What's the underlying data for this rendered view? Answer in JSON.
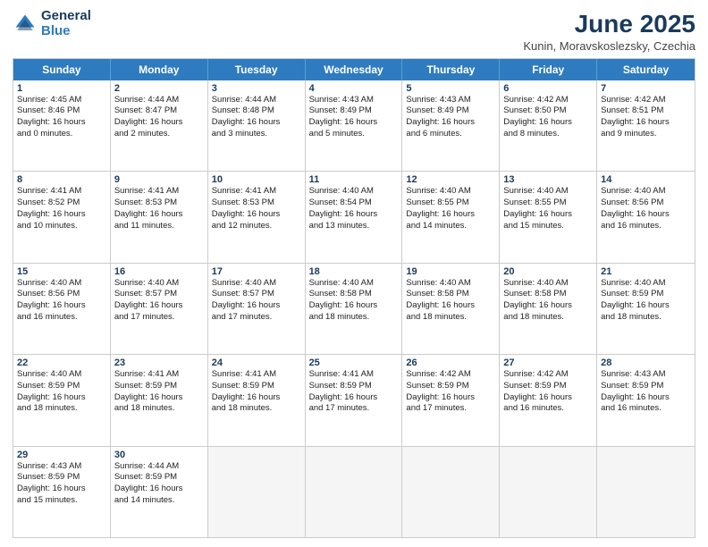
{
  "logo": {
    "general": "General",
    "blue": "Blue"
  },
  "title": "June 2025",
  "location": "Kunin, Moravskoslezsky, Czechia",
  "days_of_week": [
    "Sunday",
    "Monday",
    "Tuesday",
    "Wednesday",
    "Thursday",
    "Friday",
    "Saturday"
  ],
  "weeks": [
    [
      {
        "day": "1",
        "lines": [
          "Sunrise: 4:45 AM",
          "Sunset: 8:46 PM",
          "Daylight: 16 hours",
          "and 0 minutes."
        ]
      },
      {
        "day": "2",
        "lines": [
          "Sunrise: 4:44 AM",
          "Sunset: 8:47 PM",
          "Daylight: 16 hours",
          "and 2 minutes."
        ]
      },
      {
        "day": "3",
        "lines": [
          "Sunrise: 4:44 AM",
          "Sunset: 8:48 PM",
          "Daylight: 16 hours",
          "and 3 minutes."
        ]
      },
      {
        "day": "4",
        "lines": [
          "Sunrise: 4:43 AM",
          "Sunset: 8:49 PM",
          "Daylight: 16 hours",
          "and 5 minutes."
        ]
      },
      {
        "day": "5",
        "lines": [
          "Sunrise: 4:43 AM",
          "Sunset: 8:49 PM",
          "Daylight: 16 hours",
          "and 6 minutes."
        ]
      },
      {
        "day": "6",
        "lines": [
          "Sunrise: 4:42 AM",
          "Sunset: 8:50 PM",
          "Daylight: 16 hours",
          "and 8 minutes."
        ]
      },
      {
        "day": "7",
        "lines": [
          "Sunrise: 4:42 AM",
          "Sunset: 8:51 PM",
          "Daylight: 16 hours",
          "and 9 minutes."
        ]
      }
    ],
    [
      {
        "day": "8",
        "lines": [
          "Sunrise: 4:41 AM",
          "Sunset: 8:52 PM",
          "Daylight: 16 hours",
          "and 10 minutes."
        ]
      },
      {
        "day": "9",
        "lines": [
          "Sunrise: 4:41 AM",
          "Sunset: 8:53 PM",
          "Daylight: 16 hours",
          "and 11 minutes."
        ]
      },
      {
        "day": "10",
        "lines": [
          "Sunrise: 4:41 AM",
          "Sunset: 8:53 PM",
          "Daylight: 16 hours",
          "and 12 minutes."
        ]
      },
      {
        "day": "11",
        "lines": [
          "Sunrise: 4:40 AM",
          "Sunset: 8:54 PM",
          "Daylight: 16 hours",
          "and 13 minutes."
        ]
      },
      {
        "day": "12",
        "lines": [
          "Sunrise: 4:40 AM",
          "Sunset: 8:55 PM",
          "Daylight: 16 hours",
          "and 14 minutes."
        ]
      },
      {
        "day": "13",
        "lines": [
          "Sunrise: 4:40 AM",
          "Sunset: 8:55 PM",
          "Daylight: 16 hours",
          "and 15 minutes."
        ]
      },
      {
        "day": "14",
        "lines": [
          "Sunrise: 4:40 AM",
          "Sunset: 8:56 PM",
          "Daylight: 16 hours",
          "and 16 minutes."
        ]
      }
    ],
    [
      {
        "day": "15",
        "lines": [
          "Sunrise: 4:40 AM",
          "Sunset: 8:56 PM",
          "Daylight: 16 hours",
          "and 16 minutes."
        ]
      },
      {
        "day": "16",
        "lines": [
          "Sunrise: 4:40 AM",
          "Sunset: 8:57 PM",
          "Daylight: 16 hours",
          "and 17 minutes."
        ]
      },
      {
        "day": "17",
        "lines": [
          "Sunrise: 4:40 AM",
          "Sunset: 8:57 PM",
          "Daylight: 16 hours",
          "and 17 minutes."
        ]
      },
      {
        "day": "18",
        "lines": [
          "Sunrise: 4:40 AM",
          "Sunset: 8:58 PM",
          "Daylight: 16 hours",
          "and 18 minutes."
        ]
      },
      {
        "day": "19",
        "lines": [
          "Sunrise: 4:40 AM",
          "Sunset: 8:58 PM",
          "Daylight: 16 hours",
          "and 18 minutes."
        ]
      },
      {
        "day": "20",
        "lines": [
          "Sunrise: 4:40 AM",
          "Sunset: 8:58 PM",
          "Daylight: 16 hours",
          "and 18 minutes."
        ]
      },
      {
        "day": "21",
        "lines": [
          "Sunrise: 4:40 AM",
          "Sunset: 8:59 PM",
          "Daylight: 16 hours",
          "and 18 minutes."
        ]
      }
    ],
    [
      {
        "day": "22",
        "lines": [
          "Sunrise: 4:40 AM",
          "Sunset: 8:59 PM",
          "Daylight: 16 hours",
          "and 18 minutes."
        ]
      },
      {
        "day": "23",
        "lines": [
          "Sunrise: 4:41 AM",
          "Sunset: 8:59 PM",
          "Daylight: 16 hours",
          "and 18 minutes."
        ]
      },
      {
        "day": "24",
        "lines": [
          "Sunrise: 4:41 AM",
          "Sunset: 8:59 PM",
          "Daylight: 16 hours",
          "and 18 minutes."
        ]
      },
      {
        "day": "25",
        "lines": [
          "Sunrise: 4:41 AM",
          "Sunset: 8:59 PM",
          "Daylight: 16 hours",
          "and 17 minutes."
        ]
      },
      {
        "day": "26",
        "lines": [
          "Sunrise: 4:42 AM",
          "Sunset: 8:59 PM",
          "Daylight: 16 hours",
          "and 17 minutes."
        ]
      },
      {
        "day": "27",
        "lines": [
          "Sunrise: 4:42 AM",
          "Sunset: 8:59 PM",
          "Daylight: 16 hours",
          "and 16 minutes."
        ]
      },
      {
        "day": "28",
        "lines": [
          "Sunrise: 4:43 AM",
          "Sunset: 8:59 PM",
          "Daylight: 16 hours",
          "and 16 minutes."
        ]
      }
    ],
    [
      {
        "day": "29",
        "lines": [
          "Sunrise: 4:43 AM",
          "Sunset: 8:59 PM",
          "Daylight: 16 hours",
          "and 15 minutes."
        ]
      },
      {
        "day": "30",
        "lines": [
          "Sunrise: 4:44 AM",
          "Sunset: 8:59 PM",
          "Daylight: 16 hours",
          "and 14 minutes."
        ]
      },
      {
        "day": "",
        "lines": []
      },
      {
        "day": "",
        "lines": []
      },
      {
        "day": "",
        "lines": []
      },
      {
        "day": "",
        "lines": []
      },
      {
        "day": "",
        "lines": []
      }
    ]
  ]
}
